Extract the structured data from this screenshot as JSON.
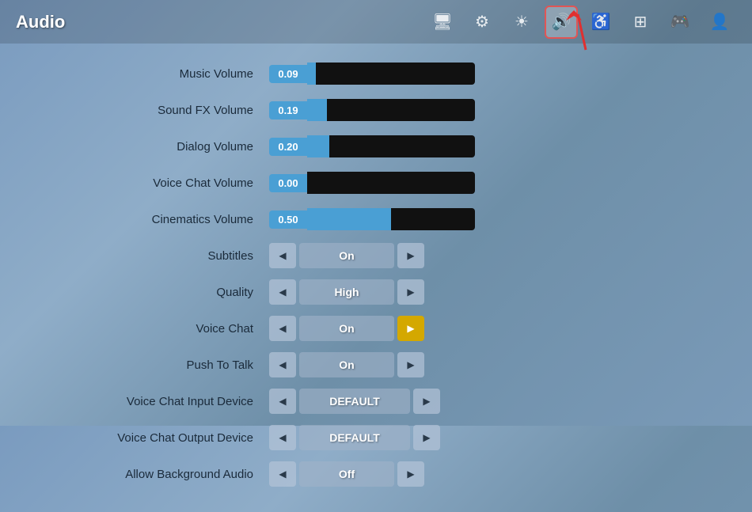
{
  "header": {
    "title": "Audio",
    "nav_icons": [
      {
        "name": "monitor-icon",
        "symbol": "🖥",
        "active": false
      },
      {
        "name": "settings-icon",
        "symbol": "⚙",
        "active": false
      },
      {
        "name": "brightness-icon",
        "symbol": "☀",
        "active": false
      },
      {
        "name": "audio-icon",
        "symbol": "🔊",
        "active": true
      },
      {
        "name": "accessibility-icon",
        "symbol": "♿",
        "active": false
      },
      {
        "name": "network-icon",
        "symbol": "⊞",
        "active": false
      },
      {
        "name": "gamepad-icon",
        "symbol": "🎮",
        "active": false
      },
      {
        "name": "account-icon",
        "symbol": "👤",
        "active": false
      }
    ]
  },
  "settings": {
    "sliders": [
      {
        "label": "Music Volume",
        "value": "0.09",
        "fill_pct": 5
      },
      {
        "label": "Sound FX Volume",
        "value": "0.19",
        "fill_pct": 12
      },
      {
        "label": "Dialog Volume",
        "value": "0.20",
        "fill_pct": 13
      },
      {
        "label": "Voice Chat Volume",
        "value": "0.00",
        "fill_pct": 0
      },
      {
        "label": "Cinematics Volume",
        "value": "0.50",
        "fill_pct": 50
      }
    ],
    "selectors": [
      {
        "label": "Subtitles",
        "value": "On",
        "right_highlight": false
      },
      {
        "label": "Quality",
        "value": "High",
        "right_highlight": false
      },
      {
        "label": "Voice Chat",
        "value": "On",
        "right_highlight": true
      },
      {
        "label": "Push To Talk",
        "value": "On",
        "right_highlight": false
      },
      {
        "label": "Voice Chat Input Device",
        "value": "DEFAULT",
        "right_highlight": false,
        "wide": true
      },
      {
        "label": "Voice Chat Output Device",
        "value": "DEFAULT",
        "right_highlight": false,
        "wide": true
      },
      {
        "label": "Allow Background Audio",
        "value": "Off",
        "right_highlight": false
      }
    ]
  },
  "arrow_left": "◀",
  "arrow_right": "▶"
}
